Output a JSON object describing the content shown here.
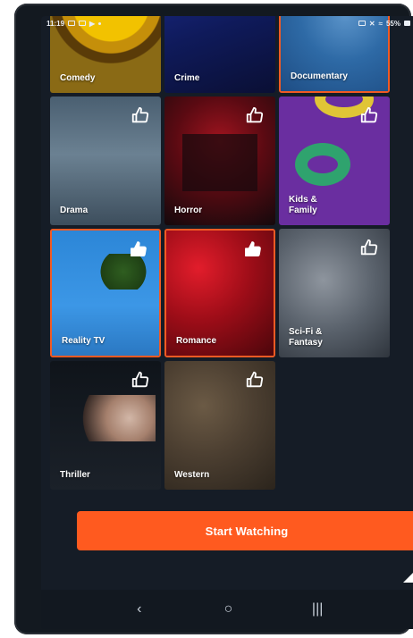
{
  "status_bar": {
    "time": "11:19",
    "battery": "55%"
  },
  "genres": [
    {
      "label": "Comedy",
      "selected": false,
      "liked": false,
      "show_thumb": false
    },
    {
      "label": "Crime",
      "selected": false,
      "liked": false,
      "show_thumb": false
    },
    {
      "label": "Documentary",
      "selected": true,
      "liked": false,
      "show_thumb": false
    },
    {
      "label": "Drama",
      "selected": false,
      "liked": false,
      "show_thumb": true
    },
    {
      "label": "Horror",
      "selected": false,
      "liked": false,
      "show_thumb": true
    },
    {
      "label": "Kids &\nFamily",
      "selected": false,
      "liked": false,
      "show_thumb": true
    },
    {
      "label": "Reality TV",
      "selected": true,
      "liked": true,
      "show_thumb": true
    },
    {
      "label": "Romance",
      "selected": true,
      "liked": true,
      "show_thumb": true
    },
    {
      "label": "Sci-Fi &\nFantasy",
      "selected": false,
      "liked": false,
      "show_thumb": true
    },
    {
      "label": "Thriller",
      "selected": false,
      "liked": false,
      "show_thumb": true
    },
    {
      "label": "Western",
      "selected": false,
      "liked": false,
      "show_thumb": true
    }
  ],
  "cta": {
    "label": "Start Watching"
  },
  "nav": {
    "back": "‹",
    "home": "○",
    "recents": "|||"
  },
  "colors": {
    "accent": "#ff5a1f",
    "background": "#151c26"
  }
}
